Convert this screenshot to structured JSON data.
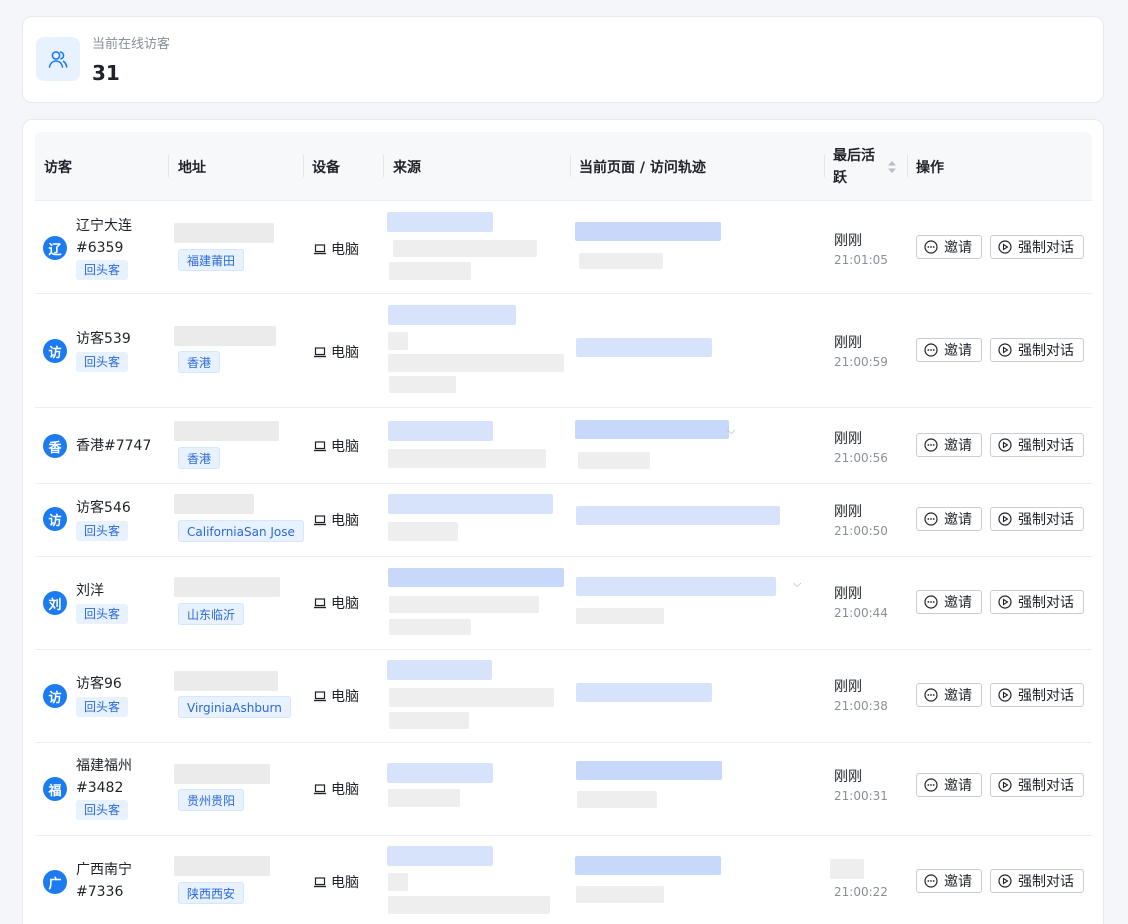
{
  "stats": {
    "label": "当前在线访客",
    "value": "31",
    "icon": "users-icon"
  },
  "table": {
    "columns": {
      "visitor": "访客",
      "address": "地址",
      "device": "设备",
      "source": "来源",
      "current_page": "当前页面 / 访问轨迹",
      "last_active": "最后活跃",
      "actions": "操作"
    },
    "invite_label": "邀请",
    "force_chat_label": "强制对话",
    "rows": [
      {
        "avatar": "辽",
        "name": "辽宁大连#6359",
        "tag": "回头客",
        "address": "福建莆田",
        "device": "电脑",
        "active": "刚刚",
        "time": "21:01:05"
      },
      {
        "avatar": "访",
        "name": "访客539",
        "tag": "回头客",
        "address": "香港",
        "device": "电脑",
        "active": "刚刚",
        "time": "21:00:59"
      },
      {
        "avatar": "香",
        "name": "香港#7747",
        "tag": "",
        "address": "香港",
        "device": "电脑",
        "active": "刚刚",
        "time": "21:00:56"
      },
      {
        "avatar": "访",
        "name": "访客546",
        "tag": "回头客",
        "address": "CaliforniaSan Jose",
        "device": "电脑",
        "active": "刚刚",
        "time": "21:00:50"
      },
      {
        "avatar": "刘",
        "name": "刘洋",
        "tag": "回头客",
        "address": "山东临沂",
        "device": "电脑",
        "active": "刚刚",
        "time": "21:00:44"
      },
      {
        "avatar": "访",
        "name": "访客96",
        "tag": "回头客",
        "address": "VirginiaAshburn",
        "device": "电脑",
        "active": "刚刚",
        "time": "21:00:38"
      },
      {
        "avatar": "福",
        "name": "福建福州#3482",
        "tag": "回头客",
        "address": "贵州贵阳",
        "device": "电脑",
        "active": "刚刚",
        "time": "21:00:31"
      },
      {
        "avatar": "广",
        "name": "广西南宁#7336",
        "tag": "",
        "address": "陕西西安",
        "device": "电脑",
        "active": "",
        "time": "21:00:22"
      }
    ]
  },
  "colors": {
    "accent": "#1d7bf0",
    "tag_bg": "#e8f1fe",
    "tag_text": "#2a6ad8"
  }
}
